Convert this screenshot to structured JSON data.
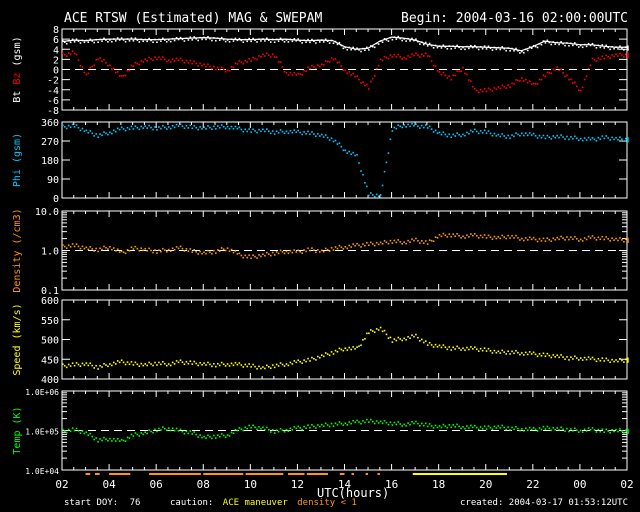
{
  "header": {
    "title": "ACE RTSW (Estimated) MAG & SWEPAM",
    "begin": "Begin: 2004-03-16 02:00:00UTC"
  },
  "footer": {
    "start_doy_label": "start DOY:",
    "start_doy": "76",
    "caution_label": "caution:",
    "maneuver_label": "ACE maneuver",
    "density_label": "density < 1",
    "created": "created: 2004-03-17 01:53:12UTC"
  },
  "colors": {
    "bt": "#ffffff",
    "bz": "#ff0000",
    "phi": "#00c8ff",
    "density": "#ff9900",
    "speed": "#ffff00",
    "temp": "#00ff00",
    "maneuver": "#ffff00",
    "lowdensity": "#ff9900"
  },
  "chart_data": {
    "type": "scatter",
    "xlabel": "UTC(hours)",
    "x_ticks": [
      "02",
      "04",
      "06",
      "08",
      "10",
      "12",
      "14",
      "16",
      "18",
      "20",
      "22",
      "00",
      "02"
    ],
    "x_start_hour": 2,
    "x_step_hours": 0.5,
    "panels": [
      {
        "id": "mag",
        "ylabel_parts": [
          "Bt",
          "Bz",
          "(gsm)"
        ],
        "ylim": [
          -8,
          8
        ],
        "scale": "linear",
        "ticks": [
          "8",
          "6",
          "4",
          "2",
          "0",
          "-2",
          "-4",
          "-6",
          "-8"
        ],
        "tick_values": [
          8,
          6,
          4,
          2,
          0,
          -2,
          -4,
          -6,
          -8
        ],
        "ref_line": 0,
        "series": [
          {
            "name": "Bt",
            "color_key": "bt",
            "values": [
              5.5,
              5.8,
              5.7,
              5.9,
              6,
              6,
              6,
              5.9,
              5.9,
              6,
              6.1,
              6.2,
              6.3,
              6.2,
              6,
              5.9,
              5.9,
              6,
              5.9,
              6,
              5.8,
              5.7,
              5.8,
              5.7,
              4.5,
              4,
              4.2,
              5.6,
              6.4,
              6.2,
              5.8,
              5,
              4.6,
              4.6,
              4.5,
              4.5,
              4.4,
              4.3,
              4.2,
              3.7,
              4.5,
              5.6,
              5.3,
              5.2,
              4.9,
              4.9,
              4.6,
              4.4,
              4.4
            ]
          },
          {
            "name": "Bz",
            "color_key": "bz",
            "values": [
              3,
              3.5,
              -1,
              2.5,
              1,
              -1.5,
              1,
              2,
              2.5,
              2,
              2,
              1.5,
              1,
              0.5,
              0,
              1.5,
              2,
              3,
              3,
              -0.5,
              -1,
              0.5,
              1,
              2.5,
              0,
              -1.5,
              -3.5,
              2,
              3,
              2.5,
              3,
              3,
              -0.5,
              -1.5,
              0.5,
              -4,
              -4,
              -3.5,
              -3,
              -1.5,
              -3,
              -1,
              0.5,
              -1.5,
              -4,
              2,
              2.5,
              3,
              3
            ]
          }
        ]
      },
      {
        "id": "phi",
        "ylabel_parts": [
          "Phi",
          "(gsm)"
        ],
        "ylim": [
          0,
          360
        ],
        "scale": "linear",
        "ticks": [
          "360",
          "270",
          "180",
          "90",
          "0"
        ],
        "tick_values": [
          360,
          270,
          180,
          90,
          0
        ],
        "series": [
          {
            "name": "Phi",
            "color_key": "phi",
            "values": [
              340,
              345,
              320,
              300,
              315,
              330,
              335,
              340,
              335,
              340,
              345,
              338,
              335,
              340,
              342,
              330,
              320,
              325,
              315,
              320,
              315,
              310,
              300,
              280,
              230,
              200,
              20,
              15,
              330,
              350,
              345,
              340,
              310,
              300,
              305,
              320,
              315,
              300,
              295,
              310,
              300,
              290,
              295,
              290,
              285,
              280,
              290,
              285,
              280
            ]
          }
        ]
      },
      {
        "id": "density",
        "ylabel_parts": [
          "Density",
          "(/cm3)"
        ],
        "ylim": [
          0.1,
          10
        ],
        "scale": "log",
        "ticks": [
          "10.0",
          "1.0",
          "0.1"
        ],
        "tick_values": [
          10,
          1,
          0.1
        ],
        "ref_line": 1,
        "series": [
          {
            "name": "Density",
            "color_key": "density",
            "values": [
              1.3,
              1.4,
              1.2,
              1.1,
              1.3,
              0.9,
              1.2,
              1.1,
              1.0,
              1.1,
              1.2,
              1.0,
              0.9,
              1.0,
              1.2,
              0.8,
              0.7,
              0.8,
              0.9,
              1.0,
              0.95,
              1.1,
              1.0,
              1.2,
              1.3,
              1.4,
              1.5,
              1.6,
              1.8,
              1.7,
              1.9,
              1.6,
              2.5,
              2.6,
              2.4,
              2.5,
              2.3,
              2.2,
              2.4,
              2.1,
              2.0,
              1.9,
              2.1,
              2.2,
              2.0,
              2.2,
              2.1,
              2.0,
              1.9
            ]
          }
        ]
      },
      {
        "id": "speed",
        "ylabel_parts": [
          "Speed",
          "(km/s)"
        ],
        "ylim": [
          400,
          600
        ],
        "scale": "linear",
        "ticks": [
          "600",
          "550",
          "500",
          "450",
          "400"
        ],
        "tick_values": [
          600,
          550,
          500,
          450,
          400
        ],
        "series": [
          {
            "name": "Speed",
            "color_key": "speed",
            "values": [
              435,
              438,
              440,
              432,
              440,
              445,
              440,
              438,
              442,
              440,
              445,
              442,
              440,
              438,
              440,
              438,
              435,
              430,
              436,
              440,
              445,
              450,
              460,
              470,
              480,
              478,
              520,
              530,
              500,
              505,
              510,
              490,
              485,
              480,
              480,
              478,
              475,
              470,
              470,
              468,
              465,
              462,
              460,
              455,
              455,
              452,
              450,
              448,
              450
            ]
          }
        ]
      },
      {
        "id": "temp",
        "ylabel_parts": [
          "Temp",
          "(K)"
        ],
        "ylim": [
          10000,
          1000000
        ],
        "scale": "log",
        "ticks": [
          "1.0E+06",
          "1.0E+05",
          "1.0E+04"
        ],
        "tick_values": [
          1000000,
          100000,
          10000
        ],
        "ref_line": 100000,
        "series": [
          {
            "name": "Temp",
            "color_key": "temp",
            "values": [
              100000,
              110000,
              90000,
              60000,
              65000,
              55000,
              80000,
              90000,
              110000,
              120000,
              100000,
              90000,
              70000,
              75000,
              80000,
              110000,
              130000,
              120000,
              100000,
              110000,
              120000,
              130000,
              140000,
              150000,
              160000,
              170000,
              180000,
              170000,
              160000,
              150000,
              160000,
              140000,
              130000,
              140000,
              130000,
              125000,
              120000,
              130000,
              120000,
              115000,
              110000,
              120000,
              115000,
              110000,
              105000,
              110000,
              100000,
              105000,
              100000
            ]
          }
        ]
      }
    ],
    "caution_intervals": {
      "density_lt_1": [
        [
          3.0,
          3.2
        ],
        [
          3.4,
          3.6
        ],
        [
          4.0,
          4.9
        ],
        [
          5.7,
          7.9
        ],
        [
          8.0,
          9.7
        ],
        [
          9.8,
          11.4
        ],
        [
          11.6,
          12.3
        ],
        [
          12.4,
          13.3
        ],
        [
          13.8,
          14.0
        ],
        [
          14.3,
          14.4
        ],
        [
          14.9,
          15.0
        ],
        [
          15.4,
          15.5
        ]
      ],
      "ace_maneuver": [
        [
          16.9,
          20.9
        ]
      ]
    }
  }
}
